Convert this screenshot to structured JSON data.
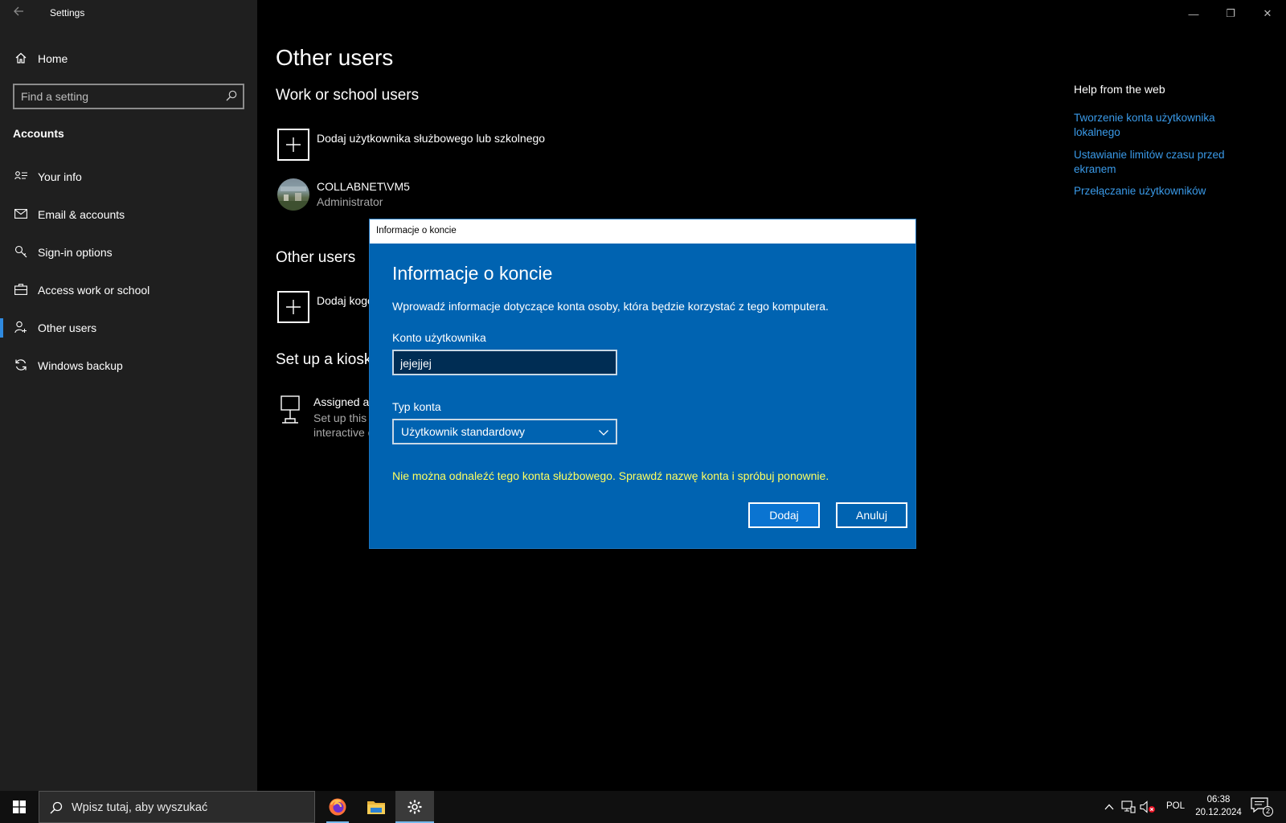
{
  "window": {
    "app_title": "Settings",
    "controls": {
      "minimize": "—",
      "maximize": "❐",
      "close": "✕"
    }
  },
  "sidebar": {
    "home_label": "Home",
    "search": {
      "placeholder": "Find a setting"
    },
    "section_title": "Accounts",
    "items": [
      {
        "label": "Your info",
        "icon": "person-card-icon"
      },
      {
        "label": "Email & accounts",
        "icon": "mail-icon"
      },
      {
        "label": "Sign-in options",
        "icon": "key-icon"
      },
      {
        "label": "Access work or school",
        "icon": "briefcase-icon"
      },
      {
        "label": "Other users",
        "icon": "add-person-icon",
        "active": true
      },
      {
        "label": "Windows backup",
        "icon": "sync-icon"
      }
    ]
  },
  "main": {
    "page_title": "Other users",
    "work_school": {
      "heading": "Work or school users",
      "add_label": "Dodaj użytkownika służbowego lub szkolnego",
      "user": {
        "name": "COLLABNET\\VM5",
        "role": "Administrator"
      }
    },
    "other_users": {
      "heading": "Other users",
      "add_label": "Dodaj kogo"
    },
    "kiosk": {
      "heading": "Set up a kiosk",
      "title": "Assigned ac",
      "desc_line1": "Set up this",
      "desc_line2": "interactive d"
    },
    "help": {
      "title": "Help from the web",
      "links": [
        "Tworzenie konta użytkownika lokalnego",
        "Ustawianie limitów czasu przed ekranem",
        "Przełączanie użytkowników"
      ]
    }
  },
  "dialog": {
    "window_title": "Informacje o koncie",
    "heading": "Informacje o koncie",
    "description": "Wprowadź informacje dotyczące konta osoby, która będzie korzystać z tego komputera.",
    "account_label": "Konto użytkownika",
    "account_value": "jejejjej",
    "type_label": "Typ konta",
    "type_value": "Użytkownik standardowy",
    "error": "Nie można odnaleźć tego konta służbowego. Sprawdź nazwę konta i spróbuj ponownie.",
    "add_button": "Dodaj",
    "cancel_button": "Anuluj",
    "colors": {
      "background": "#0063b1",
      "error": "#ffff60"
    }
  },
  "taskbar": {
    "search_placeholder": "Wpisz tutaj, aby wyszukać",
    "apps": [
      "firefox-icon",
      "file-explorer-icon",
      "settings-icon"
    ],
    "language": "POL",
    "time": "06:38",
    "date": "20.12.2024",
    "notification_count": "2"
  }
}
